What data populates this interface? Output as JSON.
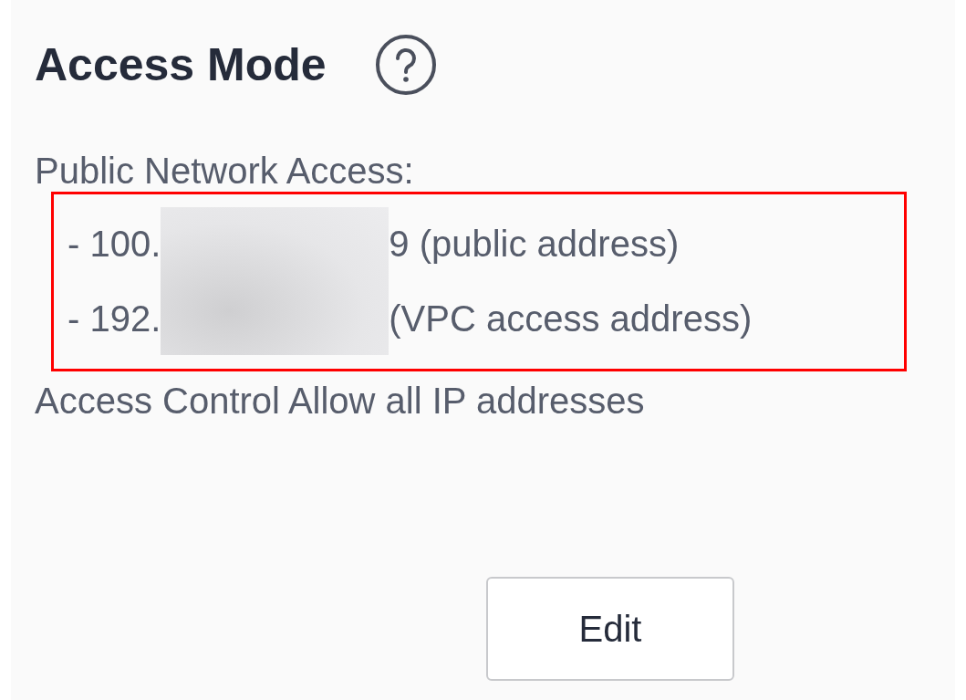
{
  "section": {
    "title": "Access Mode",
    "network_label": "Public Network Access:",
    "addresses": {
      "highlighted": true,
      "redacted": true,
      "lines": [
        {
          "prefix": "- 100.",
          "suffix": "9 (public address)"
        },
        {
          "prefix": "- 192.",
          "suffix": "(VPC access address)"
        }
      ]
    },
    "access_control": "Access Control Allow all IP addresses",
    "button": "Edit"
  }
}
